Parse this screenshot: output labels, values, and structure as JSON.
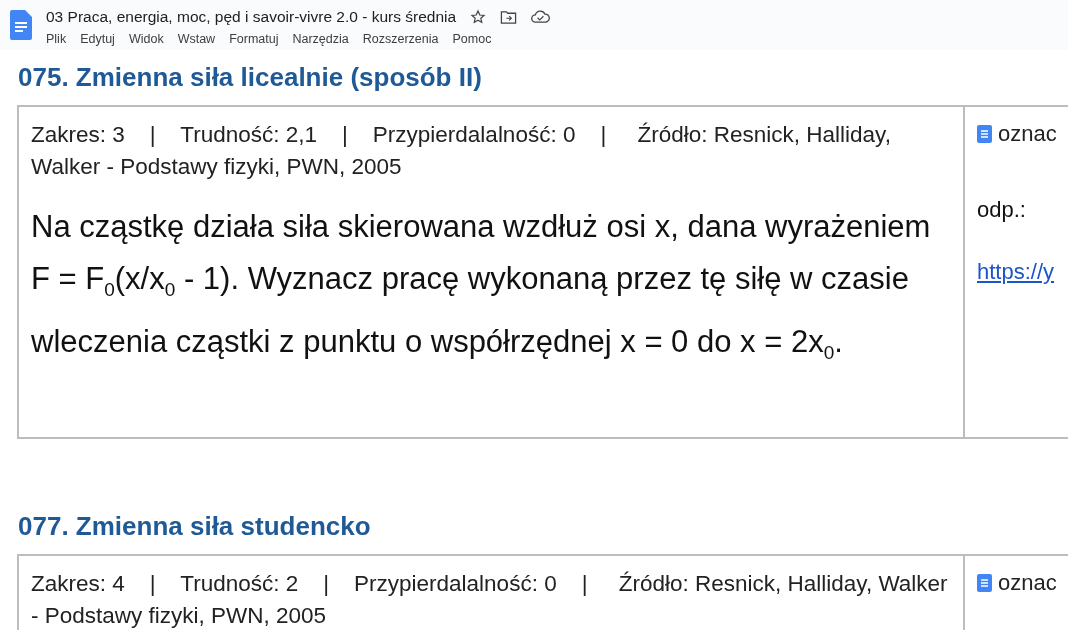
{
  "document": {
    "title": "03 Praca, energia, moc, pęd i savoir-vivre 2.0 - kurs średnia",
    "menu": [
      "Plik",
      "Edytuj",
      "Widok",
      "Wstaw",
      "Formatuj",
      "Narzędzia",
      "Rozszerzenia",
      "Pomoc"
    ]
  },
  "problems": [
    {
      "heading": "075. Zmienna siła licealnie (sposób II)",
      "meta": "Zakres: 3    |    Trudność: 2,1    |    Przypierdalalność: 0    |     Źródło: Resnick, Halliday, Walker - Podstawy fizyki, PWN, 2005",
      "text": "Na cząstkę działa siła skierowana wzdłuż osi x, dana wyrażeniem F = F$_{0}$(x/x$_{0}$ - 1). Wyznacz pracę wykonaną przez tę siłę w czasie wleczenia cząstki z punktu o współrzędnej x = 0 do x = 2x$_{0}$.",
      "side_link": "oznac",
      "answer_label": "odp.:",
      "answer_link": "https://y"
    },
    {
      "heading": "077. Zmienna siła studencko",
      "meta": "Zakres: 4    |    Trudność: 2    |    Przypierdalalność: 0    |     Źródło: Resnick, Halliday, Walker - Podstawy fizyki, PWN, 2005",
      "side_link": "oznac"
    }
  ]
}
